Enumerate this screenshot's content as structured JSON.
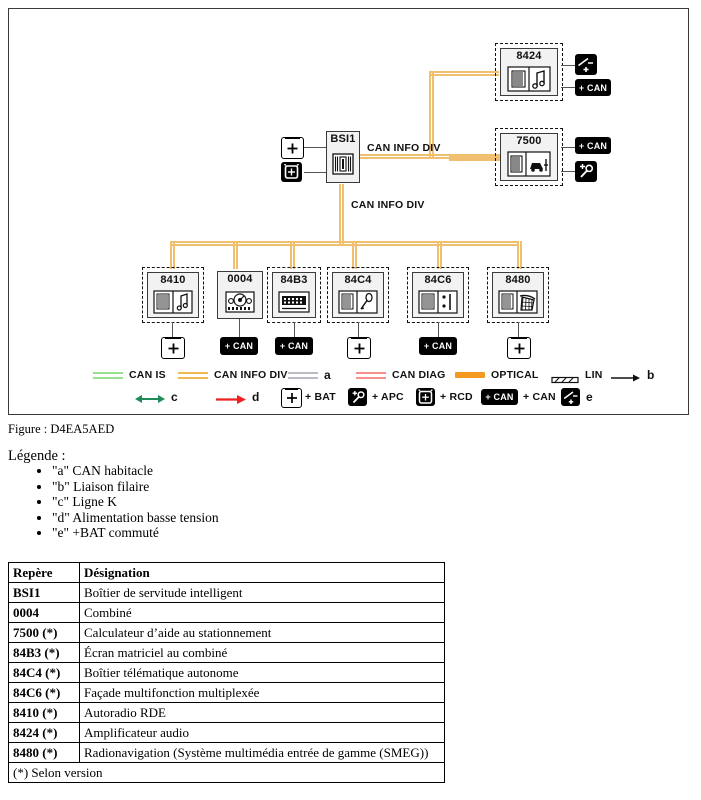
{
  "figure": {
    "caption": "Figure : D4EA5AED",
    "bus_labels": {
      "upper": "CAN INFO DIV",
      "lower": "CAN INFO DIV"
    },
    "central_module": {
      "code": "BSI1",
      "icon": "bsi-module-icon",
      "left_ports": [
        {
          "name": "bat-icon",
          "label": "+ BAT"
        },
        {
          "name": "rcd-icon",
          "label": "+ RCD"
        }
      ]
    },
    "right_modules": [
      {
        "code": "8424",
        "icon": "amplifier-icon",
        "dashed": true,
        "ports": [
          {
            "name": "switched-bat-icon",
            "label": "e"
          },
          {
            "name": "can-badge",
            "label": "+ CAN"
          }
        ]
      },
      {
        "code": "7500",
        "icon": "parking-aid-icon",
        "dashed": true,
        "ports": [
          {
            "name": "can-badge",
            "label": "+ CAN"
          },
          {
            "name": "apc-icon",
            "label": "+ APC"
          }
        ]
      }
    ],
    "bottom_modules": [
      {
        "code": "8410",
        "icon": "autoradio-icon",
        "dashed": true,
        "port": {
          "name": "bat-icon",
          "label": "+"
        }
      },
      {
        "code": "0004",
        "icon": "combine-icon",
        "dashed": false,
        "port": {
          "name": "can-badge",
          "label": "+ CAN"
        }
      },
      {
        "code": "84B3",
        "icon": "matrix-screen-icon",
        "dashed": true,
        "port": {
          "name": "can-badge",
          "label": "+ CAN"
        }
      },
      {
        "code": "84C4",
        "icon": "telematics-icon",
        "dashed": true,
        "port": {
          "name": "bat-icon",
          "label": "+"
        }
      },
      {
        "code": "84C6",
        "icon": "facade-icon",
        "dashed": true,
        "port": {
          "name": "can-badge",
          "label": "+ CAN"
        }
      },
      {
        "code": "8480",
        "icon": "navigation-icon",
        "dashed": true,
        "port": {
          "name": "bat-icon",
          "label": "+"
        }
      }
    ],
    "legend": {
      "row1": [
        {
          "name": "can-is-swatch",
          "label": "CAN IS",
          "color": "#97e08f",
          "style": "double"
        },
        {
          "name": "can-info-div-swatch",
          "label": "CAN INFO DIV",
          "color": "#f0b951",
          "style": "double"
        },
        {
          "name": "can-habitacle-swatch",
          "label": "a",
          "color": "#b9bcc0",
          "style": "double"
        },
        {
          "name": "can-diag-swatch",
          "label": "CAN DIAG",
          "color": "#f78f8f",
          "style": "double"
        },
        {
          "name": "optical-swatch",
          "label": "OPTICAL",
          "color": "#f49a22",
          "style": "solid"
        },
        {
          "name": "lin-swatch",
          "label": "LIN",
          "color": "#111111",
          "style": "lin"
        },
        {
          "name": "liaison-filaire-arrow",
          "label": "b",
          "color": "#111111",
          "style": "arrow"
        }
      ],
      "row2": [
        {
          "name": "ligne-k-arrow",
          "label": "c",
          "color": "#1f8a5a",
          "style": "double-arrow"
        },
        {
          "name": "basse-tension-arrow",
          "label": "d",
          "color": "#ee2222",
          "style": "arrow"
        },
        {
          "name": "bat-icon",
          "label": "+ BAT",
          "color": "#ffffff",
          "style": "icon-white"
        },
        {
          "name": "apc-icon",
          "label": "+ APC",
          "color": "#000000",
          "style": "icon-black"
        },
        {
          "name": "rcd-icon",
          "label": "+ RCD",
          "color": "#000000",
          "style": "icon-black"
        },
        {
          "name": "can-badge",
          "label": "+ CAN",
          "color": "#000000",
          "style": "badge"
        },
        {
          "name": "switched-bat-icon",
          "label": "e",
          "color": "#000000",
          "style": "icon-black"
        }
      ]
    }
  },
  "legende": {
    "title": "Légende :",
    "items": [
      "\"a\" CAN habitacle",
      "\"b\" Liaison filaire",
      "\"c\" Ligne K",
      "\"d\" Alimentation basse tension",
      "\"e\" +BAT commuté"
    ]
  },
  "table": {
    "headers": [
      "Repère",
      "Désignation"
    ],
    "rows": [
      [
        "BSI1",
        "Boîtier de servitude intelligent"
      ],
      [
        "0004",
        "Combiné"
      ],
      [
        "7500 (*)",
        "Calculateur d’aide au stationnement"
      ],
      [
        "84B3 (*)",
        "Écran matriciel au combiné"
      ],
      [
        "84C4 (*)",
        "Boîtier télématique autonome"
      ],
      [
        "84C6 (*)",
        "Façade multifonction multiplexée"
      ],
      [
        "8410 (*)",
        "Autoradio RDE"
      ],
      [
        "8424 (*)",
        "Amplificateur audio"
      ],
      [
        "8480 (*)",
        "Radionavigation (Système multimédia entrée de gamme (SMEG))"
      ]
    ],
    "footnote": "(*) Selon version"
  }
}
